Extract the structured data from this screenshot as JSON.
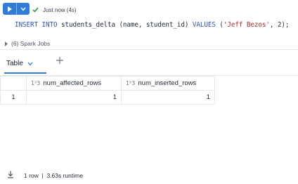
{
  "cell": {
    "status_text": "Just now (4s)",
    "code": {
      "kw1": "INSERT INTO",
      "t1": " students_delta (name, student_id) ",
      "kw2": "VALUES",
      "t2": " (",
      "str": "'Jeff Bezos'",
      "t3": ", 2);"
    },
    "spark_jobs": "(6) Spark Jobs"
  },
  "tabs": [
    {
      "label": "Table"
    }
  ],
  "table": {
    "type_icon": "1²3",
    "columns": [
      "num_affected_rows",
      "num_inserted_rows"
    ],
    "rows": [
      {
        "index": "1",
        "values": [
          "1",
          "1"
        ]
      }
    ]
  },
  "footer": {
    "summary": "1 row  |  3.63s runtime"
  },
  "colors": {
    "accent": "#2f7cdb",
    "success": "#1a9b4e"
  }
}
